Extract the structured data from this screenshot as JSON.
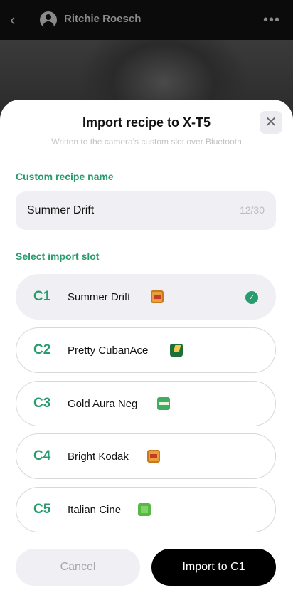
{
  "background": {
    "back_icon": "chevron-left-icon",
    "user_name": "Ritchie Roesch",
    "more_icon": "more-dots-icon"
  },
  "sheet": {
    "title": "Import recipe to X-T5",
    "subtitle": "Written to the camera's custom slot over Bluetooth",
    "close_icon": "close-icon",
    "name_section_label": "Custom recipe name",
    "recipe_name": "Summer Drift",
    "char_count": "12/30",
    "slot_section_label": "Select import slot",
    "slots": [
      {
        "id": "C1",
        "name": "Summer Drift",
        "icon": "kodak-film-icon",
        "selected": true
      },
      {
        "id": "C2",
        "name": "Pretty CubanAce",
        "icon": "cuban-film-icon",
        "selected": false
      },
      {
        "id": "C3",
        "name": "Gold Aura Neg",
        "icon": "gold-film-icon",
        "selected": false
      },
      {
        "id": "C4",
        "name": "Bright Kodak",
        "icon": "kodak-film-icon",
        "selected": false
      },
      {
        "id": "C5",
        "name": "Italian Cine",
        "icon": "cine-film-icon",
        "selected": false
      }
    ],
    "cancel_label": "Cancel",
    "import_label": "Import to C1"
  },
  "colors": {
    "accent": "#2a9b6e",
    "primary_button": "#000000",
    "field_bg": "#f0f0f4"
  }
}
